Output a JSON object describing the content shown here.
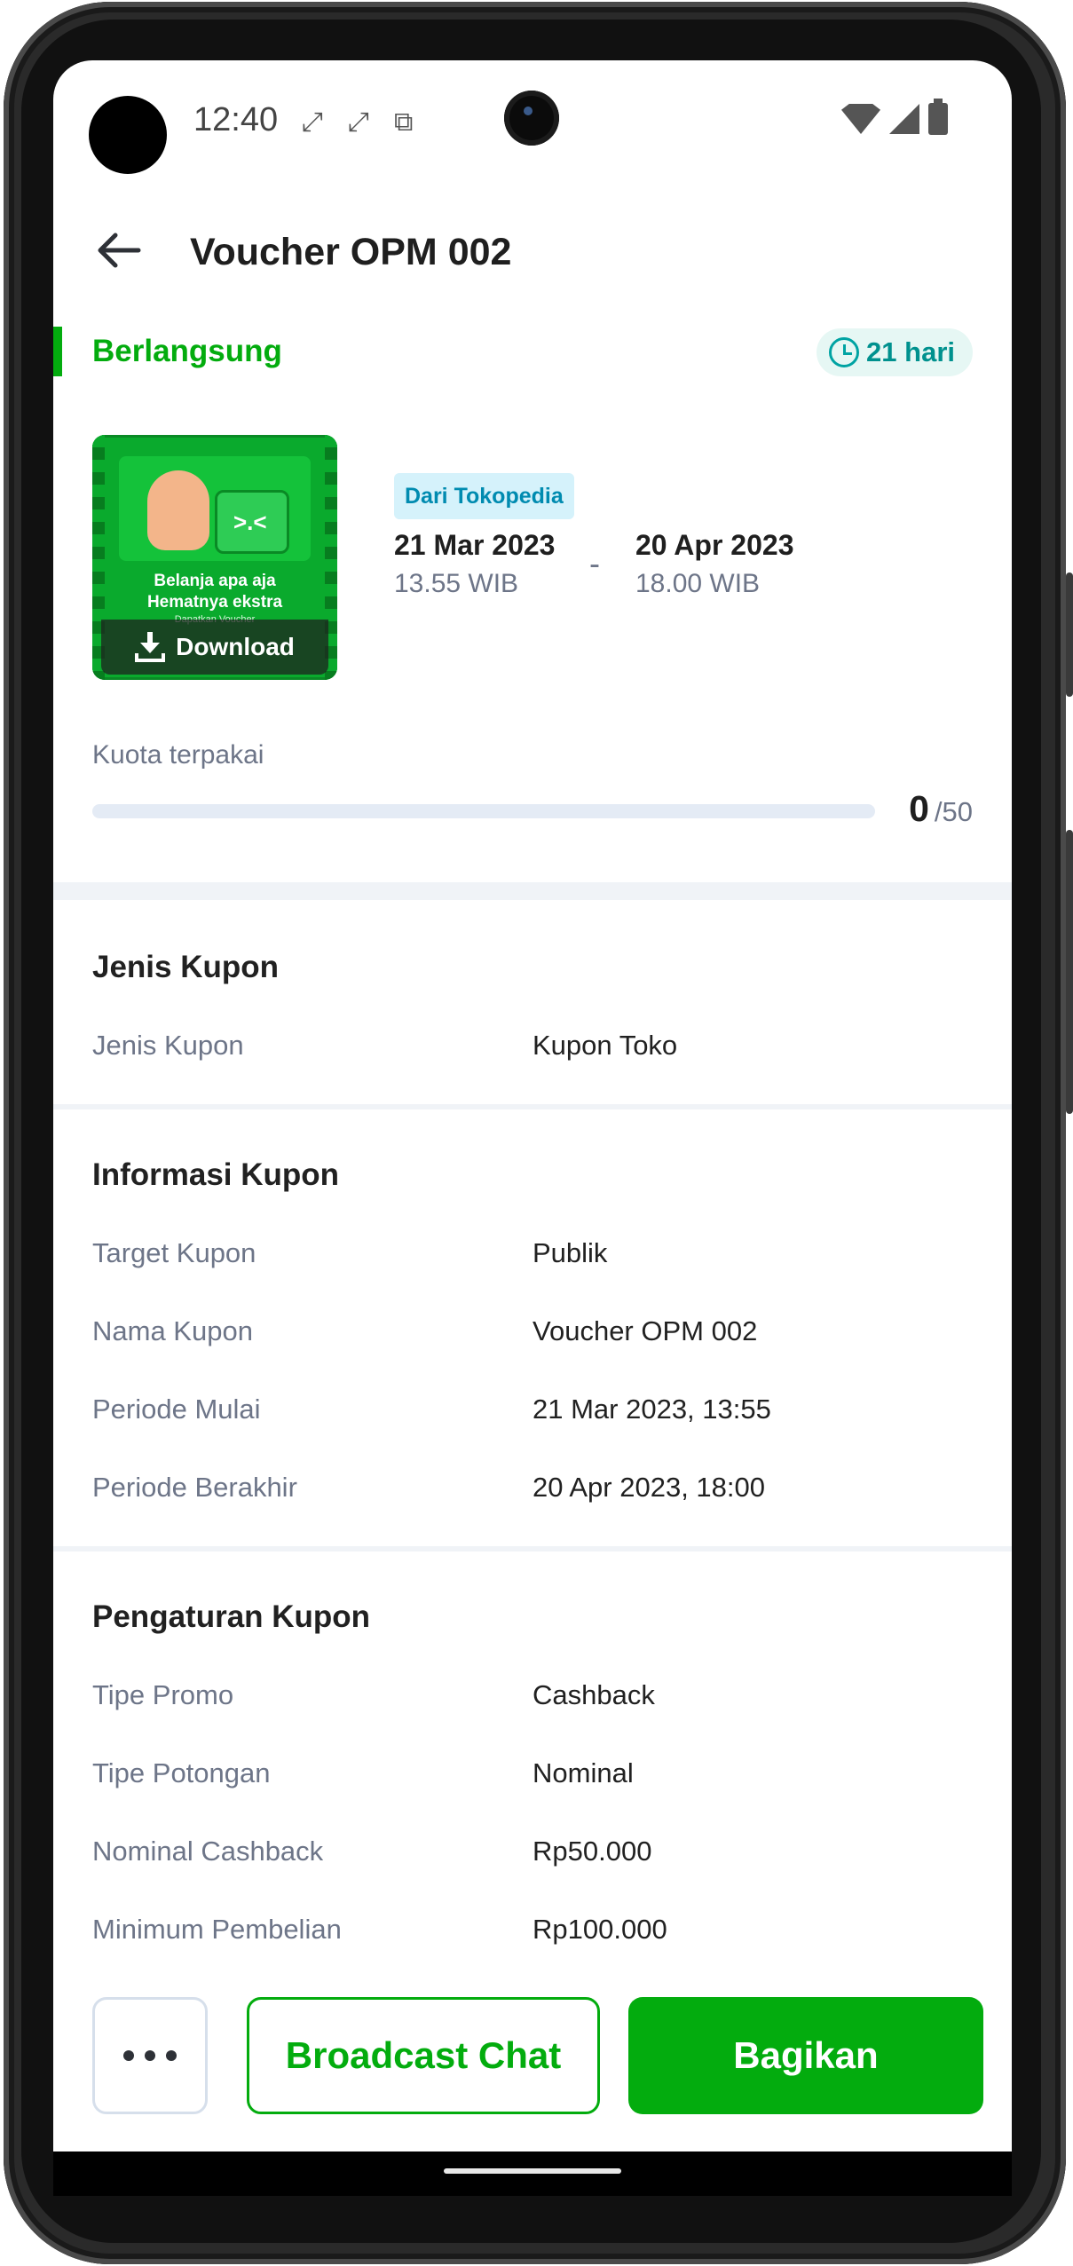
{
  "status_bar": {
    "time": "12:40",
    "notification_icons": [
      "sync-icon",
      "sync-icon",
      "screenshot-icon"
    ],
    "system_icons": [
      "wifi-icon",
      "signal-icon",
      "battery-icon"
    ]
  },
  "app_bar": {
    "title": "Voucher OPM 002"
  },
  "voucher_status": {
    "label": "Berlangsung",
    "remaining_days": "21 hari"
  },
  "voucher_image": {
    "line1": "Belanja apa aja",
    "line2": "Hematnya ekstra",
    "line3": "Dapatkan Voucher",
    "download_label": "Download"
  },
  "source": {
    "label": "Dari Tokopedia"
  },
  "period": {
    "start_date": "21 Mar 2023",
    "start_time": "13.55 WIB",
    "separator": "-",
    "end_date": "20 Apr 2023",
    "end_time": "18.00 WIB"
  },
  "quota": {
    "label": "Kuota terpakai",
    "used": "0",
    "total": "/50",
    "used_fraction": 0
  },
  "sections": {
    "jenis": {
      "title": "Jenis Kupon",
      "rows": [
        {
          "key": "Jenis Kupon",
          "value": "Kupon Toko"
        }
      ]
    },
    "informasi": {
      "title": "Informasi Kupon",
      "rows": [
        {
          "key": "Target Kupon",
          "value": "Publik"
        },
        {
          "key": "Nama Kupon",
          "value": "Voucher OPM 002"
        },
        {
          "key": "Periode Mulai",
          "value": "21 Mar 2023, 13:55"
        },
        {
          "key": "Periode Berakhir",
          "value": "20 Apr 2023, 18:00"
        }
      ]
    },
    "pengaturan": {
      "title": "Pengaturan Kupon",
      "rows": [
        {
          "key": "Tipe Promo",
          "value": "Cashback"
        },
        {
          "key": "Tipe Potongan",
          "value": "Nominal"
        },
        {
          "key": "Nominal Cashback",
          "value": "Rp50.000"
        },
        {
          "key": "Minimum Pembelian",
          "value": "Rp100.000"
        }
      ]
    }
  },
  "actions": {
    "more_icon": "more-horizontal-icon",
    "broadcast_label": "Broadcast Chat",
    "share_label": "Bagikan"
  },
  "colors": {
    "primary_green": "#03ac0e",
    "teal_chip": "#00918e",
    "source_chip_text": "#008bb0"
  }
}
